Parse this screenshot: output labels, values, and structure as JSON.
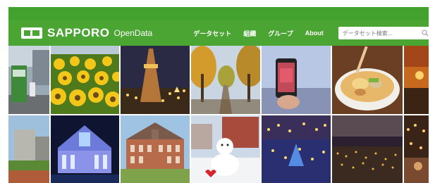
{
  "header": {
    "logo_text": "SAPPORO",
    "logo_sub": "OpenData",
    "nav": [
      {
        "label": "データセット"
      },
      {
        "label": "組織"
      },
      {
        "label": "グループ"
      },
      {
        "label": "About"
      }
    ],
    "search_placeholder": "データセット検索..."
  },
  "photos": [
    {
      "name": "photo-streetcar-icon"
    },
    {
      "name": "photo-sunflower-field-icon"
    },
    {
      "name": "photo-tv-tower-night-icon"
    },
    {
      "name": "photo-autumn-tree-path-icon"
    },
    {
      "name": "photo-phone-photo-icon"
    },
    {
      "name": "photo-ramen-bowl-icon"
    },
    {
      "name": "photo-sunset-sky-icon"
    },
    {
      "name": "photo-city-street-icon"
    },
    {
      "name": "photo-illuminated-building-icon"
    },
    {
      "name": "photo-red-brick-office-icon"
    },
    {
      "name": "photo-snowman-snow-festival-icon"
    },
    {
      "name": "photo-winter-illumination-icon"
    },
    {
      "name": "photo-night-city-view-icon"
    },
    {
      "name": "photo-lights-festival-icon"
    }
  ]
}
